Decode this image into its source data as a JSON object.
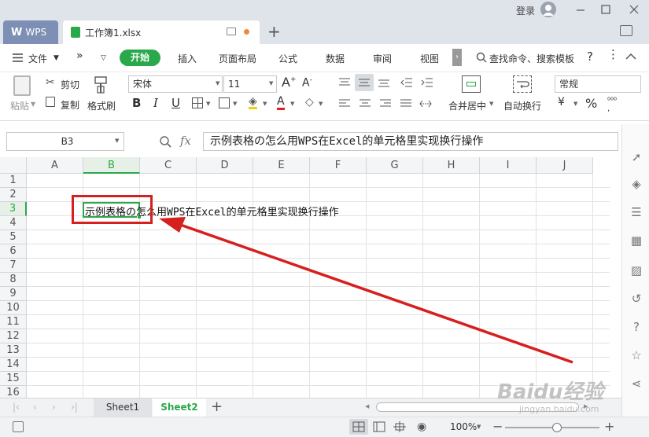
{
  "titlebar": {
    "login": "登录",
    "tabs": [
      {
        "label": "WPS"
      },
      {
        "label": "工作簿1.xlsx"
      }
    ],
    "new_tab": "+"
  },
  "menu": {
    "file": "文件",
    "items": [
      "开始",
      "插入",
      "页面布局",
      "公式",
      "数据",
      "审阅",
      "视图"
    ],
    "search": "查找命令、搜索模板"
  },
  "ribbon": {
    "paste": "粘贴",
    "cut": "剪切",
    "copy": "复制",
    "format_painter": "格式刷",
    "font_name": "宋体",
    "font_size": "11",
    "merge_center": "合并居中",
    "wrap_text": "自动换行",
    "number_format": "常规",
    "percent": "%"
  },
  "formula_bar": {
    "cell_ref": "B3",
    "fx": "fx",
    "content": "示例表格の怎么用WPS在Excel的单元格里实现换行操作"
  },
  "grid": {
    "columns": [
      "A",
      "B",
      "C",
      "D",
      "E",
      "F",
      "G",
      "H",
      "I",
      "J"
    ],
    "rows": [
      "1",
      "2",
      "3",
      "4",
      "5",
      "6",
      "7",
      "8",
      "9",
      "10",
      "11",
      "12",
      "13",
      "14",
      "15",
      "16"
    ],
    "active_cell": "B3",
    "cell_b3": "示例表格の怎么用WPS在Excel的单元格里实现换行操作"
  },
  "sheets": {
    "tabs": [
      "Sheet1",
      "Sheet2"
    ],
    "active": "Sheet2",
    "add": "+"
  },
  "status": {
    "zoom": "100%",
    "zoom_level": 0.55
  },
  "watermark": {
    "brand": "Baidu经验",
    "url": "jingyan.baidu.com"
  },
  "colors": {
    "accent_green": "#2aa84a",
    "annotation_red": "#d62020",
    "wps_tab": "#7d8fb5"
  }
}
